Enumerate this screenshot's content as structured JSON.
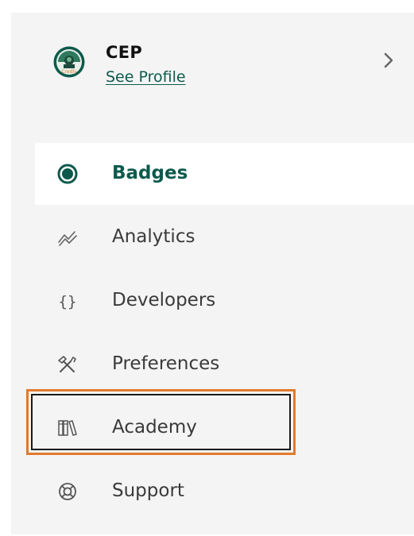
{
  "profile": {
    "name": "CEP",
    "link_label": "See Profile",
    "avatar_icon": "org-logo-icon"
  },
  "nav": {
    "active_color": "#0d5a4c",
    "items": [
      {
        "label": "Badges",
        "icon": "badge-icon",
        "active": true
      },
      {
        "label": "Analytics",
        "icon": "analytics-icon",
        "active": false
      },
      {
        "label": "Developers",
        "icon": "braces-icon",
        "active": false
      },
      {
        "label": "Preferences",
        "icon": "tools-icon",
        "active": false
      },
      {
        "label": "Academy",
        "icon": "books-icon",
        "active": false
      },
      {
        "label": "Support",
        "icon": "lifebuoy-icon",
        "active": false
      }
    ]
  },
  "highlight": {
    "target": "Academy",
    "color": "#e07a2e"
  }
}
